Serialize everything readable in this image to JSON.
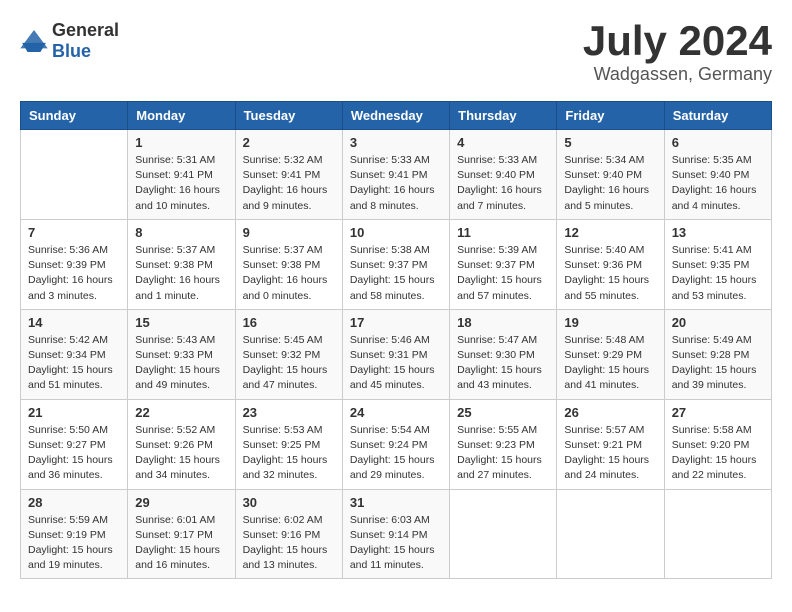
{
  "header": {
    "logo_general": "General",
    "logo_blue": "Blue",
    "month": "July 2024",
    "location": "Wadgassen, Germany"
  },
  "weekdays": [
    "Sunday",
    "Monday",
    "Tuesday",
    "Wednesday",
    "Thursday",
    "Friday",
    "Saturday"
  ],
  "weeks": [
    [
      {
        "day": "",
        "info": ""
      },
      {
        "day": "1",
        "info": "Sunrise: 5:31 AM\nSunset: 9:41 PM\nDaylight: 16 hours\nand 10 minutes."
      },
      {
        "day": "2",
        "info": "Sunrise: 5:32 AM\nSunset: 9:41 PM\nDaylight: 16 hours\nand 9 minutes."
      },
      {
        "day": "3",
        "info": "Sunrise: 5:33 AM\nSunset: 9:41 PM\nDaylight: 16 hours\nand 8 minutes."
      },
      {
        "day": "4",
        "info": "Sunrise: 5:33 AM\nSunset: 9:40 PM\nDaylight: 16 hours\nand 7 minutes."
      },
      {
        "day": "5",
        "info": "Sunrise: 5:34 AM\nSunset: 9:40 PM\nDaylight: 16 hours\nand 5 minutes."
      },
      {
        "day": "6",
        "info": "Sunrise: 5:35 AM\nSunset: 9:40 PM\nDaylight: 16 hours\nand 4 minutes."
      }
    ],
    [
      {
        "day": "7",
        "info": "Sunrise: 5:36 AM\nSunset: 9:39 PM\nDaylight: 16 hours\nand 3 minutes."
      },
      {
        "day": "8",
        "info": "Sunrise: 5:37 AM\nSunset: 9:38 PM\nDaylight: 16 hours\nand 1 minute."
      },
      {
        "day": "9",
        "info": "Sunrise: 5:37 AM\nSunset: 9:38 PM\nDaylight: 16 hours\nand 0 minutes."
      },
      {
        "day": "10",
        "info": "Sunrise: 5:38 AM\nSunset: 9:37 PM\nDaylight: 15 hours\nand 58 minutes."
      },
      {
        "day": "11",
        "info": "Sunrise: 5:39 AM\nSunset: 9:37 PM\nDaylight: 15 hours\nand 57 minutes."
      },
      {
        "day": "12",
        "info": "Sunrise: 5:40 AM\nSunset: 9:36 PM\nDaylight: 15 hours\nand 55 minutes."
      },
      {
        "day": "13",
        "info": "Sunrise: 5:41 AM\nSunset: 9:35 PM\nDaylight: 15 hours\nand 53 minutes."
      }
    ],
    [
      {
        "day": "14",
        "info": "Sunrise: 5:42 AM\nSunset: 9:34 PM\nDaylight: 15 hours\nand 51 minutes."
      },
      {
        "day": "15",
        "info": "Sunrise: 5:43 AM\nSunset: 9:33 PM\nDaylight: 15 hours\nand 49 minutes."
      },
      {
        "day": "16",
        "info": "Sunrise: 5:45 AM\nSunset: 9:32 PM\nDaylight: 15 hours\nand 47 minutes."
      },
      {
        "day": "17",
        "info": "Sunrise: 5:46 AM\nSunset: 9:31 PM\nDaylight: 15 hours\nand 45 minutes."
      },
      {
        "day": "18",
        "info": "Sunrise: 5:47 AM\nSunset: 9:30 PM\nDaylight: 15 hours\nand 43 minutes."
      },
      {
        "day": "19",
        "info": "Sunrise: 5:48 AM\nSunset: 9:29 PM\nDaylight: 15 hours\nand 41 minutes."
      },
      {
        "day": "20",
        "info": "Sunrise: 5:49 AM\nSunset: 9:28 PM\nDaylight: 15 hours\nand 39 minutes."
      }
    ],
    [
      {
        "day": "21",
        "info": "Sunrise: 5:50 AM\nSunset: 9:27 PM\nDaylight: 15 hours\nand 36 minutes."
      },
      {
        "day": "22",
        "info": "Sunrise: 5:52 AM\nSunset: 9:26 PM\nDaylight: 15 hours\nand 34 minutes."
      },
      {
        "day": "23",
        "info": "Sunrise: 5:53 AM\nSunset: 9:25 PM\nDaylight: 15 hours\nand 32 minutes."
      },
      {
        "day": "24",
        "info": "Sunrise: 5:54 AM\nSunset: 9:24 PM\nDaylight: 15 hours\nand 29 minutes."
      },
      {
        "day": "25",
        "info": "Sunrise: 5:55 AM\nSunset: 9:23 PM\nDaylight: 15 hours\nand 27 minutes."
      },
      {
        "day": "26",
        "info": "Sunrise: 5:57 AM\nSunset: 9:21 PM\nDaylight: 15 hours\nand 24 minutes."
      },
      {
        "day": "27",
        "info": "Sunrise: 5:58 AM\nSunset: 9:20 PM\nDaylight: 15 hours\nand 22 minutes."
      }
    ],
    [
      {
        "day": "28",
        "info": "Sunrise: 5:59 AM\nSunset: 9:19 PM\nDaylight: 15 hours\nand 19 minutes."
      },
      {
        "day": "29",
        "info": "Sunrise: 6:01 AM\nSunset: 9:17 PM\nDaylight: 15 hours\nand 16 minutes."
      },
      {
        "day": "30",
        "info": "Sunrise: 6:02 AM\nSunset: 9:16 PM\nDaylight: 15 hours\nand 13 minutes."
      },
      {
        "day": "31",
        "info": "Sunrise: 6:03 AM\nSunset: 9:14 PM\nDaylight: 15 hours\nand 11 minutes."
      },
      {
        "day": "",
        "info": ""
      },
      {
        "day": "",
        "info": ""
      },
      {
        "day": "",
        "info": ""
      }
    ]
  ]
}
